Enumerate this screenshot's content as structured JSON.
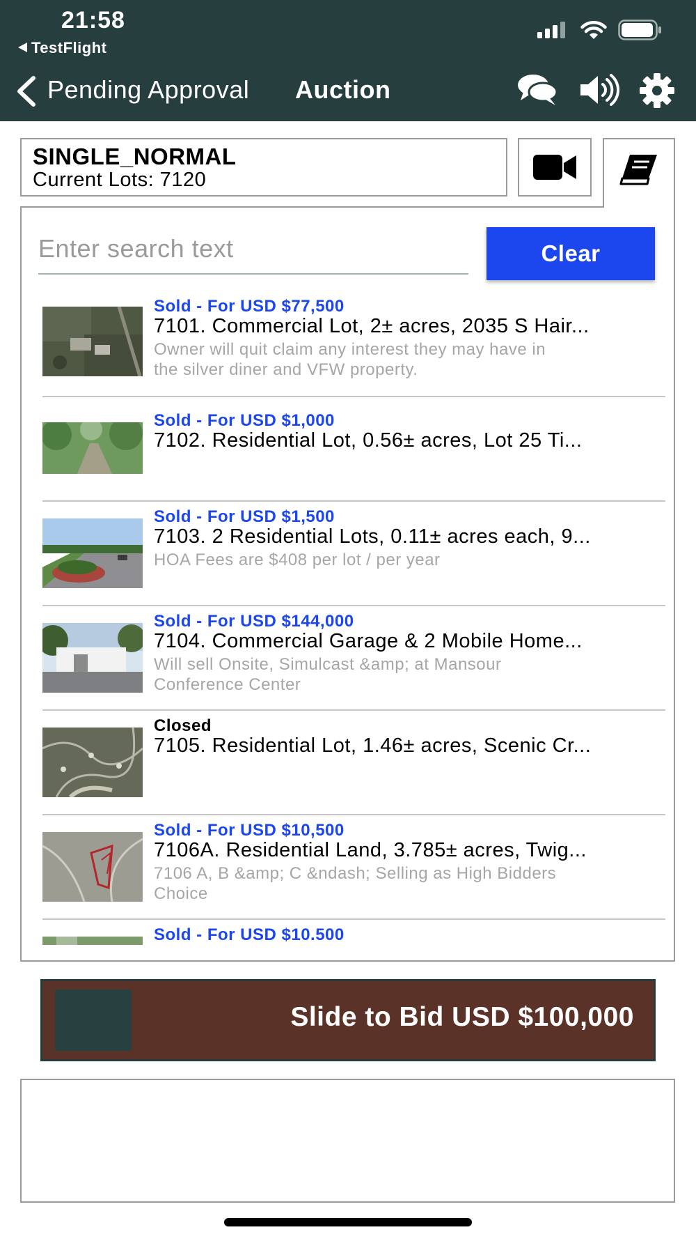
{
  "status_bar": {
    "time": "21:58",
    "back_app": "TestFlight",
    "icons": [
      "cellular-signal-icon",
      "wifi-icon",
      "battery-icon"
    ]
  },
  "header": {
    "back_label": "Pending Approval",
    "title": "Auction",
    "icons": [
      "chat-icon",
      "speaker-icon",
      "gear-icon"
    ],
    "background": "#263f3e"
  },
  "sale": {
    "name": "SINGLE_NORMAL",
    "lots_label": "Current Lots: 7120",
    "icons": [
      "video-camera-icon",
      "catalog-book-icon"
    ]
  },
  "search": {
    "placeholder": "Enter search text",
    "value": "",
    "clear_label": "Clear",
    "clear_color": "#1c47ee"
  },
  "lots": [
    {
      "status": "Sold - For USD $77,500",
      "title": "7101. Commercial Lot, 2± acres, 2035 S Hair...",
      "desc_line1": "Owner will quit claim any interest they may have in",
      "desc_line2": "the silver diner and VFW property."
    },
    {
      "status": "Sold - For USD $1,000",
      "title": "7102. Residential Lot, 0.56± acres, Lot 25 Ti...",
      "desc_line1": "",
      "desc_line2": ""
    },
    {
      "status": "Sold - For USD $1,500",
      "title": "7103. 2 Residential Lots, 0.11± acres each, 9...",
      "desc_line1": "HOA Fees are $408 per lot / per year",
      "desc_line2": ""
    },
    {
      "status": "Sold - For USD $144,000",
      "title": "7104. Commercial Garage & 2 Mobile Home...",
      "desc_line1": "Will sell Onsite, Simulcast &amp; at Mansour",
      "desc_line2": "Conference Center"
    },
    {
      "status": "Closed",
      "title": "7105. Residential Lot, 1.46± acres, Scenic Cr...",
      "desc_line1": "",
      "desc_line2": ""
    },
    {
      "status": "Sold - For USD $10,500",
      "title": "7106A. Residential Land, 3.785± acres, Twig...",
      "desc_line1": "7106 A, B &amp; C &ndash; Selling as High Bidders",
      "desc_line2": "Choice"
    },
    {
      "status": "Sold - For USD $10.500",
      "title": "",
      "desc_line1": "",
      "desc_line2": ""
    }
  ],
  "colors": {
    "sold_status": "#1c47ee",
    "closed_status": "#000000",
    "bid_bar": "#5b3228",
    "bid_handle": "#264140"
  },
  "bid": {
    "label": "Slide to Bid USD $100,000"
  }
}
